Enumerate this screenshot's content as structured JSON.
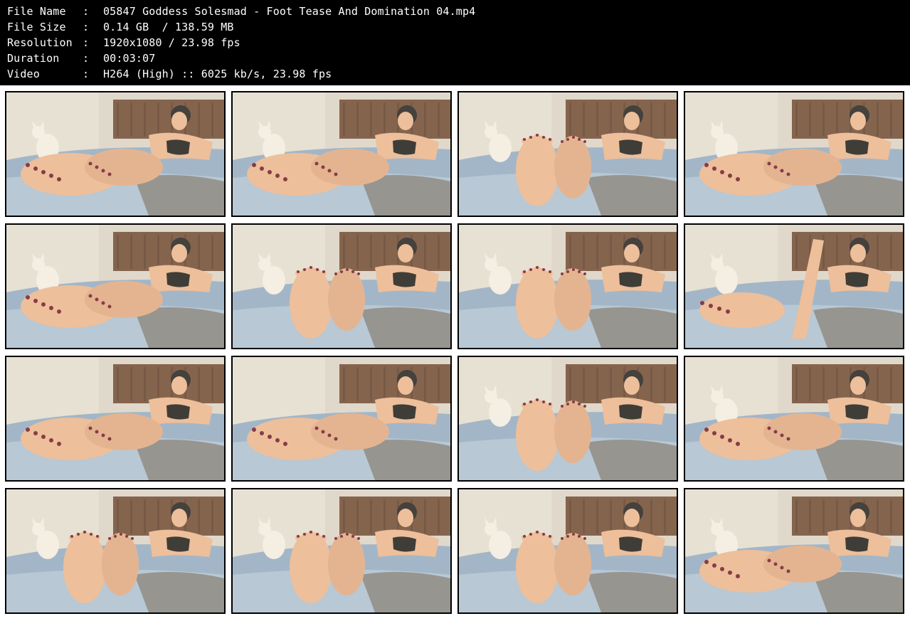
{
  "header": {
    "rows": [
      {
        "label": "File Name",
        "colon": ":",
        "value": "05847 Goddess Solesmad - Foot Tease And Domination 04.mp4"
      },
      {
        "label": "File Size",
        "colon": ":",
        "value": "0.14 GB  / 138.59 MB"
      },
      {
        "label": "Resolution",
        "colon": ":",
        "value": "1920x1080 / 23.98 fps"
      },
      {
        "label": "Duration",
        "colon": ":",
        "value": "00:03:07"
      },
      {
        "label": "Video",
        "colon": ":",
        "value": "H264 (High) :: 6025 kb/s, 23.98 fps"
      }
    ]
  },
  "thumbnails": [
    {
      "name": "thumbnail-frame-01",
      "cat": true,
      "pose": "soles-left"
    },
    {
      "name": "thumbnail-frame-02",
      "cat": true,
      "pose": "soles-left"
    },
    {
      "name": "thumbnail-frame-03",
      "cat": true,
      "pose": "soles-raised"
    },
    {
      "name": "thumbnail-frame-04",
      "cat": true,
      "pose": "soles-left"
    },
    {
      "name": "thumbnail-frame-05",
      "cat": true,
      "pose": "soles-left"
    },
    {
      "name": "thumbnail-frame-06",
      "cat": true,
      "pose": "soles-raised"
    },
    {
      "name": "thumbnail-frame-07",
      "cat": true,
      "pose": "soles-raised"
    },
    {
      "name": "thumbnail-frame-08",
      "cat": true,
      "pose": "leg-up"
    },
    {
      "name": "thumbnail-frame-09",
      "cat": false,
      "pose": "soles-left"
    },
    {
      "name": "thumbnail-frame-10",
      "cat": false,
      "pose": "soles-left"
    },
    {
      "name": "thumbnail-frame-11",
      "cat": true,
      "pose": "soles-raised"
    },
    {
      "name": "thumbnail-frame-12",
      "cat": true,
      "pose": "soles-left"
    },
    {
      "name": "thumbnail-frame-13",
      "cat": true,
      "pose": "soles-raised"
    },
    {
      "name": "thumbnail-frame-14",
      "cat": true,
      "pose": "soles-raised"
    },
    {
      "name": "thumbnail-frame-15",
      "cat": true,
      "pose": "soles-raised"
    },
    {
      "name": "thumbnail-frame-16",
      "cat": true,
      "pose": "soles-left"
    }
  ],
  "colors": {
    "header_bg": "#000000",
    "header_text": "#ffffff",
    "frame_bg": "#ffffff",
    "wall": "#d9d3c8",
    "headboard": "#6b4530",
    "bedding": "#8fa9c4",
    "blanket": "#7c7a78",
    "skin": "#e9b48e",
    "nail": "#6e1426",
    "bra": "#151515",
    "hair": "#1d1a1a",
    "cat": "#f2ede6"
  }
}
